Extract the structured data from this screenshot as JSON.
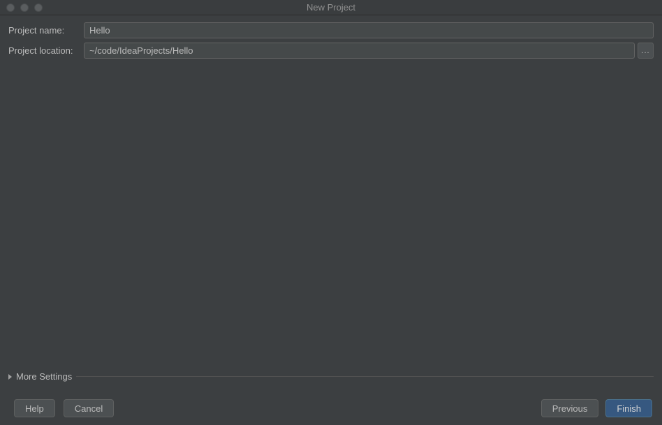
{
  "window": {
    "title": "New Project"
  },
  "form": {
    "projectName": {
      "label": "Project name:",
      "value": "Hello"
    },
    "projectLocation": {
      "label": "Project location:",
      "value": "~/code/IdeaProjects/Hello",
      "browseLabel": "..."
    }
  },
  "moreSettings": {
    "label": "More Settings"
  },
  "buttons": {
    "help": "Help",
    "cancel": "Cancel",
    "previous": "Previous",
    "finish": "Finish"
  }
}
